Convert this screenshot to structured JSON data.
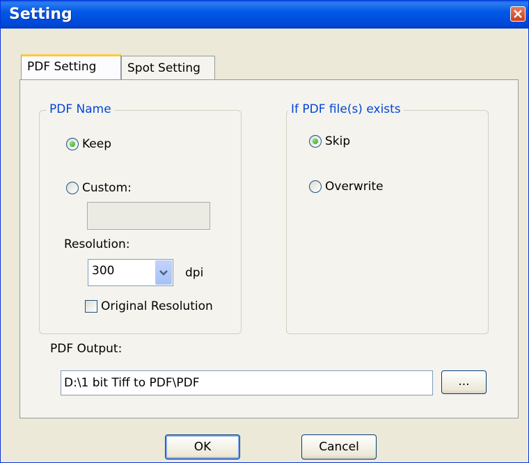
{
  "window": {
    "title": "Setting"
  },
  "tabs": [
    {
      "label": "PDF Setting",
      "active": true
    },
    {
      "label": "Spot Setting",
      "active": false
    }
  ],
  "pdf_name": {
    "legend": "PDF Name",
    "keep_label": "Keep",
    "keep_checked": true,
    "custom_label": "Custom:",
    "custom_checked": false,
    "custom_value": ""
  },
  "resolution": {
    "label": "Resolution:",
    "value": "300",
    "unit": "dpi",
    "original_label": "Original Resolution",
    "original_checked": false
  },
  "if_exists": {
    "legend": "If PDF file(s) exists",
    "skip_label": "Skip",
    "skip_checked": true,
    "overwrite_label": "Overwrite",
    "overwrite_checked": false
  },
  "output": {
    "label": "PDF Output:",
    "path": "D:\\1 bit Tiff to PDF\\PDF",
    "browse_label": "..."
  },
  "buttons": {
    "ok": "OK",
    "cancel": "Cancel"
  },
  "colors": {
    "titlebar": "#0058e6",
    "legend_text": "#0046d5",
    "dialog_bg": "#ece9d8"
  }
}
